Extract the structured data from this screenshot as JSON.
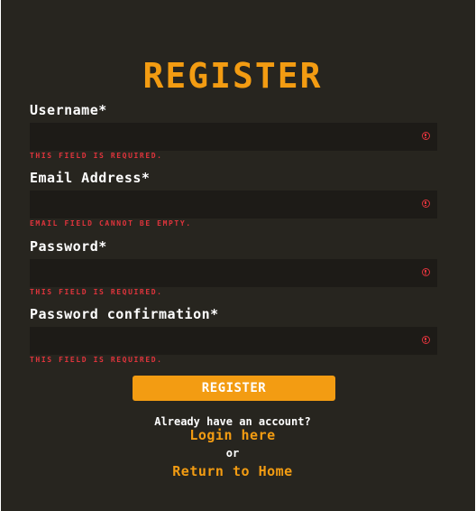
{
  "form": {
    "title": "REGISTER",
    "fields": [
      {
        "label": "Username*",
        "value": "",
        "placeholder": "",
        "error": "THIS FIELD IS REQUIRED."
      },
      {
        "label": "Email Address*",
        "value": "",
        "placeholder": "",
        "error": "EMAIL FIELD CANNOT BE EMPTY."
      },
      {
        "label": "Password*",
        "value": "",
        "placeholder": "",
        "error": "THIS FIELD IS REQUIRED."
      },
      {
        "label": "Password confirmation*",
        "value": "",
        "placeholder": "",
        "error": "THIS FIELD IS REQUIRED."
      }
    ],
    "submit_label": "REGISTER"
  },
  "footer": {
    "already_text": "Already have an account?",
    "login_link": "Login here",
    "or_text": "or",
    "home_link": "Return to Home"
  },
  "colors": {
    "background": "#27251f",
    "field_background": "#1d1b17",
    "accent": "#f39c12",
    "error": "#e0343c",
    "text": "#ffffff"
  },
  "icons": {
    "field_status": "error-circle-icon"
  }
}
